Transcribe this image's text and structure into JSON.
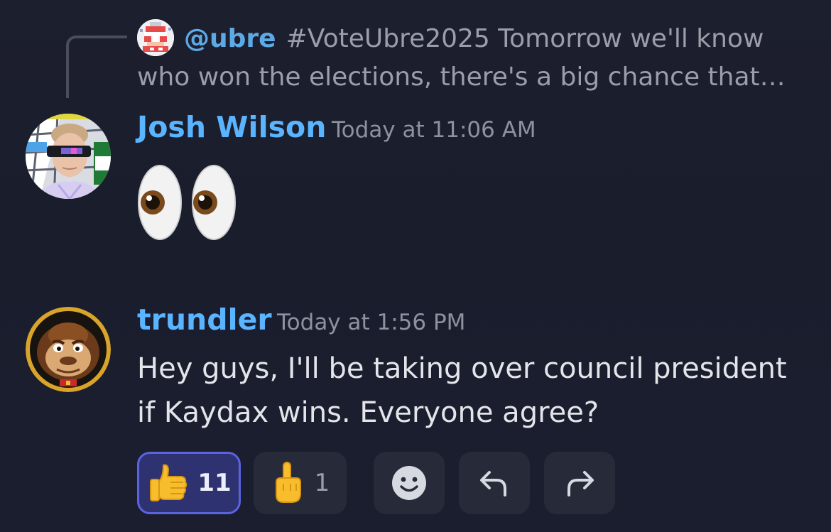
{
  "reply_reference": {
    "mention": "@ubre",
    "line1": "#VoteUbre2025 Tomorrow we'll know",
    "line2": "who won the elections, there's a big chance that …"
  },
  "messages": [
    {
      "username": "Josh Wilson",
      "timestamp": "Today at 11:06 AM",
      "content_emoji": "eyes"
    },
    {
      "username": "trundler",
      "timestamp": "Today at 1:56 PM",
      "content_line1": "Hey guys, I'll be taking over council president",
      "content_line2": "if Kaydax wins. Everyone agree?"
    }
  ],
  "reactions": [
    {
      "emoji": "thumbs-up",
      "count": "11",
      "reacted": true
    },
    {
      "emoji": "pointing-finger",
      "count": "1",
      "reacted": false
    }
  ],
  "actions": [
    "add-reaction",
    "reply",
    "forward"
  ],
  "colors": {
    "background": "#1c1f2e",
    "username": "#5ab4ff",
    "mention": "#5da9e6",
    "reacted_pill": "#2e3270",
    "reacted_border": "#5b63e0",
    "pill": "#262a39"
  }
}
